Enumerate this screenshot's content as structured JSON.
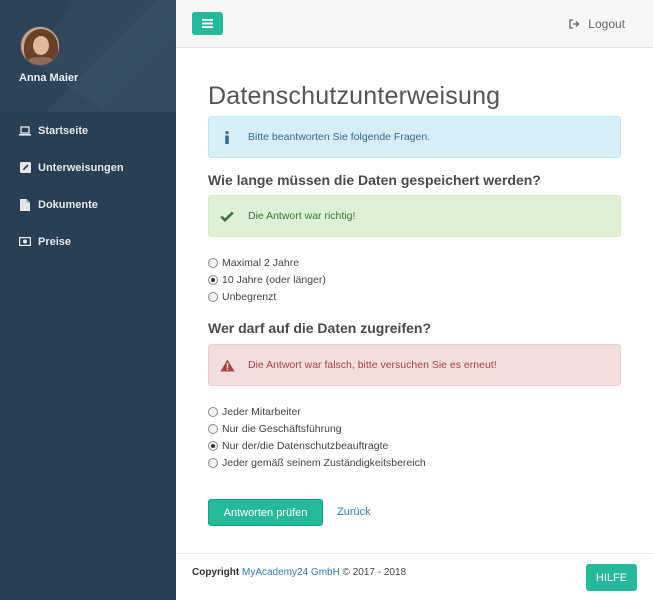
{
  "user": {
    "name": "Anna Maier"
  },
  "sidebar": {
    "items": [
      {
        "label": "Startseite",
        "icon": "laptop-icon"
      },
      {
        "label": "Unterweisungen",
        "icon": "edit-icon"
      },
      {
        "label": "Dokumente",
        "icon": "file-icon"
      },
      {
        "label": "Preise",
        "icon": "money-icon"
      }
    ]
  },
  "topbar": {
    "logout_label": "Logout"
  },
  "main": {
    "title": "Datenschutzunterweisung",
    "info_message": "Bitte beantworten Sie folgende Fragen.",
    "questions": [
      {
        "text": "Wie lange müssen die Daten gespeichert werden?",
        "feedback": "Die Antwort war richtig!",
        "feedback_status": "success",
        "options": [
          {
            "label": "Maximal 2 Jahre",
            "selected": false
          },
          {
            "label": "10 Jahre (oder länger)",
            "selected": true
          },
          {
            "label": "Unbegrenzt",
            "selected": false
          }
        ]
      },
      {
        "text": "Wer darf auf die Daten zugreifen?",
        "feedback": "Die Antwort war falsch, bitte versuchen Sie es erneut!",
        "feedback_status": "error",
        "options": [
          {
            "label": "Jeder Mitarbeiter",
            "selected": false
          },
          {
            "label": "Nur die Geschäftsführung",
            "selected": false
          },
          {
            "label": "Nur der/die Datenschutzbeauftragte",
            "selected": true
          },
          {
            "label": "Jeder gemäß seinem Zuständigkeitsbereich",
            "selected": false
          }
        ]
      }
    ],
    "submit_label": "Antworten prüfen",
    "back_label": "Zurück"
  },
  "footer": {
    "copyright_label": "Copyright",
    "company": "MyAcademy24 GmbH",
    "years": "© 2017 - 2018",
    "help_label": "HILFE"
  },
  "colors": {
    "sidebar": "#2a3f54",
    "accent": "#26b99a",
    "info": "#d9edf7",
    "success": "#dff0d8",
    "danger": "#f2dede",
    "link": "#337ab7"
  }
}
